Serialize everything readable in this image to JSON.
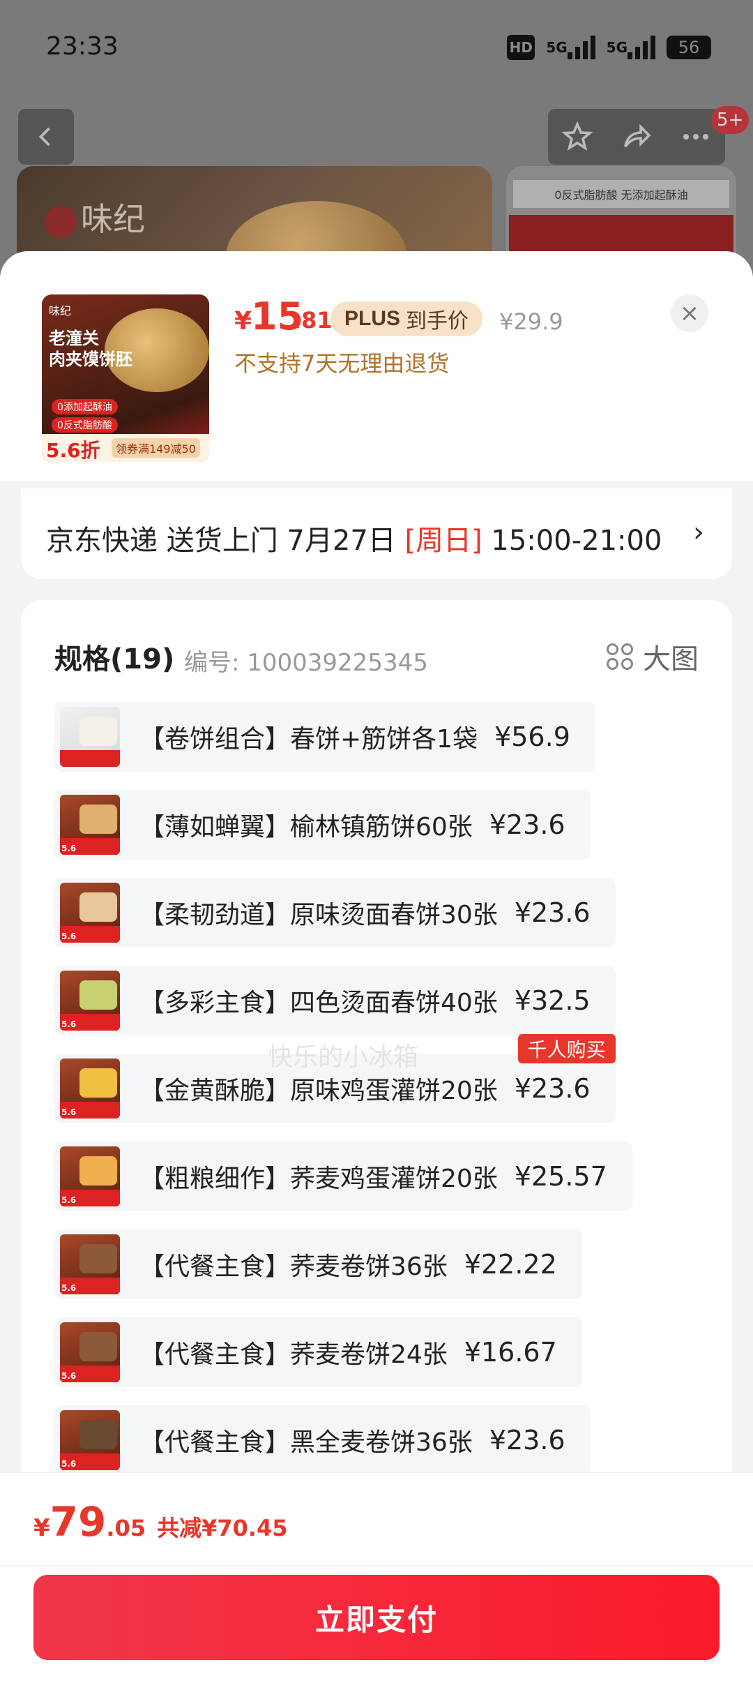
{
  "status_bar": {
    "time": "23:33",
    "hd": "HD",
    "net1": "5G",
    "net2": "5G",
    "battery": "56"
  },
  "nav": {
    "more_badge": "5+"
  },
  "background": {
    "brand": "味纪",
    "right_banner": "0反式脂肪酸 无添加起酥油"
  },
  "product": {
    "thumb_brand": "味纪",
    "thumb_title_line1": "老潼关",
    "thumb_title_line2": "肉夹馍饼胚",
    "thumb_tag1": "0添加起酥油",
    "thumb_tag2": "0反式脂肪酸",
    "thumb_discount": "5.6折",
    "thumb_coupon": "领券满149减50",
    "price_currency": "¥",
    "price_int": "15",
    "price_dec": ".81",
    "plus_word": "PLUS",
    "plus_text": "到手价",
    "original_price": "¥29.9",
    "no_return": "不支持7天无理由退货",
    "close_icon": "×"
  },
  "delivery": {
    "text_before": "京东快递 送货上门 7月27日 ",
    "day": "[周日]",
    "text_after": " 15:00-21:00",
    "chevron": "›"
  },
  "spec": {
    "title": "规格(19)",
    "code": "编号: 100039225345",
    "big_view": "大图",
    "options": [
      {
        "label": "【卷饼组合】春饼+筋饼各1袋",
        "price": "¥56.9"
      },
      {
        "label": "【薄如蝉翼】榆林镇筋饼60张",
        "price": "¥23.6"
      },
      {
        "label": "【柔韧劲道】原味烫面春饼30张",
        "price": "¥23.6"
      },
      {
        "label": "【多彩主食】四色烫面春饼40张",
        "price": "¥32.5"
      },
      {
        "label": "【金黄酥脆】原味鸡蛋灌饼20张",
        "price": "¥23.6",
        "tag": "千人购买"
      },
      {
        "label": "【粗粮细作】荞麦鸡蛋灌饼20张",
        "price": "¥25.57"
      },
      {
        "label": "【代餐主食】荞麦卷饼36张",
        "price": "¥22.22"
      },
      {
        "label": "【代餐主食】荞麦卷饼24张",
        "price": "¥16.67"
      },
      {
        "label": "【代餐主食】黑全麦卷饼36张",
        "price": "¥23.6"
      }
    ],
    "thumb_discount": "5.6"
  },
  "watermark": "快乐的小冰箱",
  "footer": {
    "currency": "¥",
    "total_int": "79",
    "total_dec": ".05",
    "savings": "共减¥70.45",
    "pay_label": "立即支付"
  },
  "colors": {
    "accent": "#e8362a",
    "plus_bg": "#f7e2c9",
    "return_text": "#b0732a"
  }
}
